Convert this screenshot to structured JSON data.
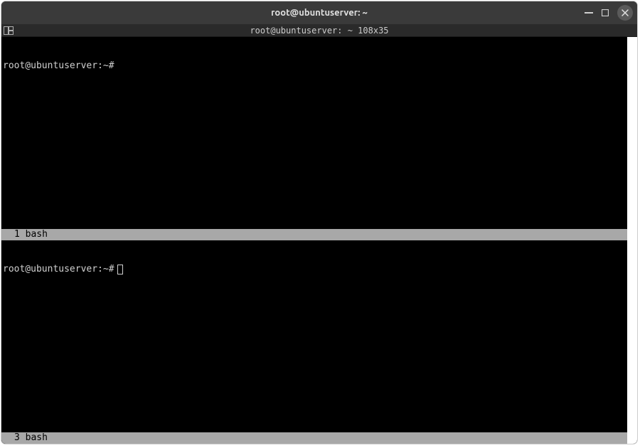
{
  "titlebar": {
    "title": "root@ubuntuserver: ~"
  },
  "tabbar": {
    "label": "root@ubuntuserver: ~ 108x35"
  },
  "panes": [
    {
      "prompt": "root@ubuntuserver:~#",
      "status": "1 bash",
      "has_cursor": false
    },
    {
      "prompt": "root@ubuntuserver:~#",
      "status": "3 bash",
      "has_cursor": true
    }
  ]
}
